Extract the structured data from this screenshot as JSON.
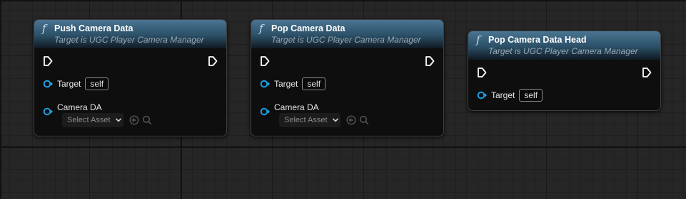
{
  "nodes": [
    {
      "title": "Push Camera Data",
      "subtitle": "Target is UGC Player Camera Manager",
      "target_label": "Target",
      "target_value": "self",
      "camera_label": "Camera DA",
      "asset_placeholder": "Select Asset"
    },
    {
      "title": "Pop Camera Data",
      "subtitle": "Target is UGC Player Camera Manager",
      "target_label": "Target",
      "target_value": "self",
      "camera_label": "Camera DA",
      "asset_placeholder": "Select Asset"
    },
    {
      "title": "Pop Camera Data Head",
      "subtitle": "Target is UGC Player Camera Manager",
      "target_label": "Target",
      "target_value": "self"
    }
  ],
  "function_icon_glyph": "f",
  "colors": {
    "canvas_bg": "#262626",
    "header_accent": "#3c6784",
    "object_pin": "#1b9fe6",
    "exec_pin": "#ffffff"
  },
  "icons": [
    "function-icon",
    "exec-pin-icon",
    "object-pin-icon",
    "chevron-down-icon",
    "browse-to-asset-icon",
    "search-icon"
  ]
}
